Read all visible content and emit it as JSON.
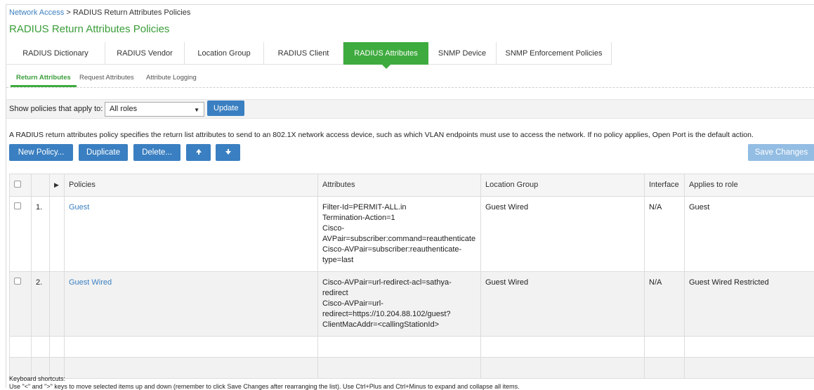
{
  "breadcrumb": {
    "root": "Network Access",
    "separator": ">",
    "current": "RADIUS Return Attributes Policies"
  },
  "page_title": "RADIUS Return Attributes Policies",
  "tabs": [
    {
      "label": "RADIUS Dictionary"
    },
    {
      "label": "RADIUS Vendor"
    },
    {
      "label": "Location Group"
    },
    {
      "label": "RADIUS Client"
    },
    {
      "label": "RADIUS Attributes",
      "active": true
    },
    {
      "label": "SNMP Device"
    },
    {
      "label": "SNMP Enforcement Policies"
    }
  ],
  "subtabs": [
    {
      "label": "Return Attributes",
      "active": true
    },
    {
      "label": "Request Attributes"
    },
    {
      "label": "Attribute Logging"
    }
  ],
  "filter": {
    "label": "Show policies that apply to:",
    "selected": "All roles",
    "update_label": "Update"
  },
  "description": "A RADIUS return attributes policy specifies the return list attributes to send to an 802.1X network access device, such as which VLAN endpoints must use to access the network. If no policy applies, Open Port is the default action.",
  "actions": {
    "new_policy": "New Policy...",
    "duplicate": "Duplicate",
    "delete": "Delete...",
    "save_changes": "Save Changes"
  },
  "table": {
    "headers": {
      "policies": "Policies",
      "attributes": "Attributes",
      "location_group": "Location Group",
      "interface": "Interface",
      "applies_to_role": "Applies to role"
    },
    "rows": [
      {
        "num": "1.",
        "policy": "Guest",
        "attributes": [
          "Filter-Id=PERMIT-ALL.in",
          "Termination-Action=1",
          "Cisco-",
          "AVPair=subscriber:command=reauthenticate",
          "Cisco-AVPair=subscriber:reauthenticate-",
          "type=last"
        ],
        "location_group": "Guest Wired",
        "interface": "N/A",
        "role": "Guest"
      },
      {
        "num": "2.",
        "policy": "Guest Wired",
        "attributes": [
          "Cisco-AVPair=url-redirect-acl=sathya-",
          "redirect",
          "Cisco-AVPair=url-",
          "redirect=https://10.204.88.102/guest?",
          "ClientMacAddr=<callingStationId>"
        ],
        "location_group": "Guest Wired",
        "interface": "N/A",
        "role": "Guest Wired Restricted"
      }
    ]
  },
  "keyboard": {
    "title": "Keyboard shortcuts:",
    "line": "Use \"<\" and \">\" keys to move selected items up and down (remember to click Save Changes after rearranging the list). Use Ctrl+Plus and Ctrl+Minus to expand and collapse all items."
  }
}
